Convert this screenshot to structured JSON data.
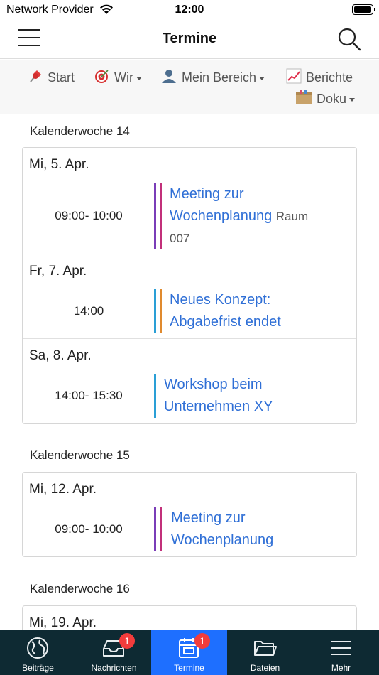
{
  "status_bar": {
    "carrier": "Network Provider",
    "time": "12:00"
  },
  "nav": {
    "title": "Termine",
    "menu_icon": "hamburger-icon",
    "search_icon": "search-icon"
  },
  "menu": {
    "start": "Start",
    "wir": "Wir",
    "mein_bereich": "Mein Bereich",
    "berichte": "Berichte",
    "doku": "Doku"
  },
  "weeks": [
    {
      "title": "Kalenderwoche 14",
      "days": [
        {
          "label": "Mi, 5. Apr.",
          "time": "09:00- 10:00",
          "title_line1": "Meeting zur",
          "title_line2": "Wochenplanung",
          "room": "Raum 007",
          "room_part1": "Raum",
          "room_part2": "007"
        },
        {
          "label": "Fr, 7. Apr.",
          "time": "14:00",
          "title_line1": "Neues Konzept:",
          "title_line2": "Abgabefrist endet"
        },
        {
          "label": "Sa, 8. Apr.",
          "time": "14:00- 15:30",
          "title_line1": "Workshop beim",
          "title_line2": "Unternehmen XY"
        }
      ]
    },
    {
      "title": "Kalenderwoche 15",
      "days": [
        {
          "label": "Mi, 12. Apr.",
          "time": "09:00- 10:00",
          "title_line1": "Meeting zur",
          "title_line2": "Wochenplanung"
        }
      ]
    },
    {
      "title": "Kalenderwoche 16",
      "days": [
        {
          "label": "Mi, 19. Apr."
        }
      ]
    }
  ],
  "colors": {
    "purple": "#7a3db8",
    "magenta": "#c2307a",
    "blue": "#2a9fd6",
    "orange": "#e08a2e",
    "link": "#2f6fd6",
    "tab_bg": "#0e2a33",
    "tab_active": "#1e6fff",
    "badge": "#f23c3c"
  },
  "tabs": [
    {
      "label": "Beiträge",
      "icon": "globe-icon"
    },
    {
      "label": "Nachrichten",
      "icon": "inbox-icon",
      "badge": "1"
    },
    {
      "label": "Termine",
      "icon": "calendar-icon",
      "badge": "1",
      "active": true
    },
    {
      "label": "Dateien",
      "icon": "folder-icon"
    },
    {
      "label": "Mehr",
      "icon": "menu-icon"
    }
  ]
}
